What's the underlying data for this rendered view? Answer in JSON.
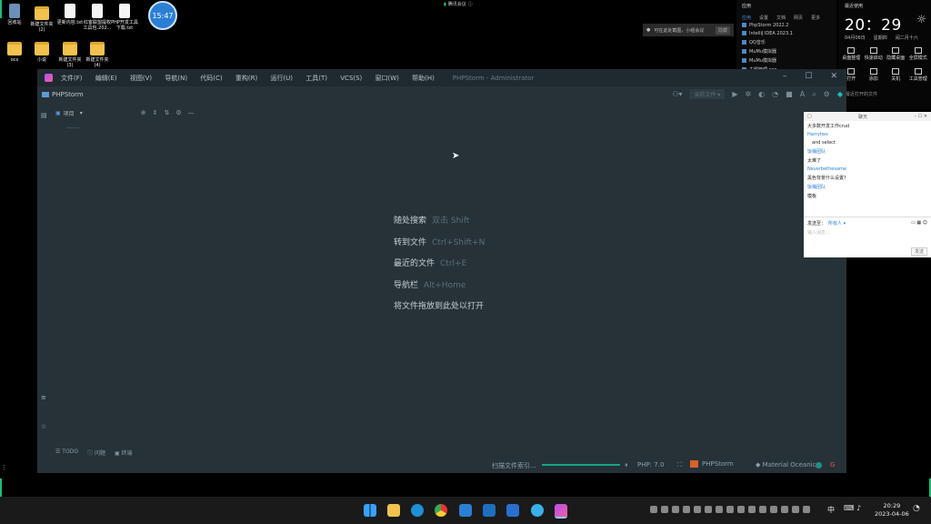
{
  "desktop": {
    "icons": [
      {
        "label": "回收站",
        "kind": "bin"
      },
      {
        "label": "新建文件夹 (2)",
        "kind": "folder"
      },
      {
        "label": "更新内容.txt",
        "kind": "file"
      },
      {
        "label": "红客联盟提权工具包.202...",
        "kind": "file"
      },
      {
        "label": "PHP开发工具下载.txt",
        "kind": "file"
      },
      {
        "label": "ocx",
        "kind": "folder"
      },
      {
        "label": "小说",
        "kind": "folder"
      },
      {
        "label": "新建文件夹 (3)",
        "kind": "folder"
      },
      {
        "label": "新建文件夹 (4)",
        "kind": "folder"
      }
    ],
    "clock_bubble": "15:47"
  },
  "meeting_bar": {
    "label": "腾讯会议"
  },
  "notification": {
    "text": "可在此处截图，小组会议",
    "button": "隐藏"
  },
  "recent_panel": {
    "title": "应用",
    "tabs": [
      "应用",
      "设置",
      "文档",
      "网页",
      "更多"
    ],
    "items": [
      "PhpStorm 2022.2",
      "IntelliJ IDEA 2023.1",
      "QQ音乐",
      "MuMu模拟器",
      "MuMu模拟器",
      "主题管理.exe"
    ]
  },
  "clock_panel": {
    "header": "最近使用",
    "time": "20：29",
    "date": "04月06日",
    "weekday": "星期四",
    "lunar": "闰二月十六",
    "actions": [
      "桌面整理",
      "快速启动",
      "隐藏桌面",
      "全屏模式",
      "打开",
      "添加",
      "关机",
      "工具管理"
    ],
    "footer": "最近打开的文件"
  },
  "ide": {
    "app_title": "PHPStorm",
    "window_title": "PHPStorm - Administrator",
    "menu": [
      "文件(F)",
      "编辑(E)",
      "视图(V)",
      "导航(N)",
      "代码(C)",
      "重构(R)",
      "运行(U)",
      "工具(T)",
      "VCS(S)",
      "窗口(W)",
      "帮助(H)"
    ],
    "run_config": "当前文件",
    "project_panel_label": "项目",
    "hints": [
      {
        "action": "随处搜索",
        "shortcut": "双击 Shift"
      },
      {
        "action": "转到文件",
        "shortcut": "Ctrl+Shift+N"
      },
      {
        "action": "最近的文件",
        "shortcut": "Ctrl+E"
      },
      {
        "action": "导航栏",
        "shortcut": "Alt+Home"
      },
      {
        "action": "将文件拖放到此处以打开",
        "shortcut": ""
      }
    ],
    "bottom_tabs": [
      "TODO",
      "问题",
      "终端"
    ],
    "status": {
      "scan": "扫描文件索引...",
      "php": "PHP: 7.0",
      "product": "PHPStorm",
      "theme": "Material Oceanic"
    }
  },
  "chat": {
    "title": "聊天",
    "messages": [
      {
        "sender": "",
        "text": "大多数开发工作crud"
      },
      {
        "sender": "Harrytwo",
        "text": "and select"
      },
      {
        "sender": "饭桶团队",
        "text": "太难了"
      },
      {
        "sender": "Neverbethesame",
        "text": "黑色背景什么设置?"
      },
      {
        "sender": "饭桶团队",
        "text": "模板"
      }
    ],
    "send_to_label": "发送至：",
    "send_to_value": "所有人",
    "input_placeholder": "输入消息...",
    "send_button": "发送"
  },
  "taskbar": {
    "time": "20:29",
    "date": "2023-04-06",
    "ime": "中"
  }
}
